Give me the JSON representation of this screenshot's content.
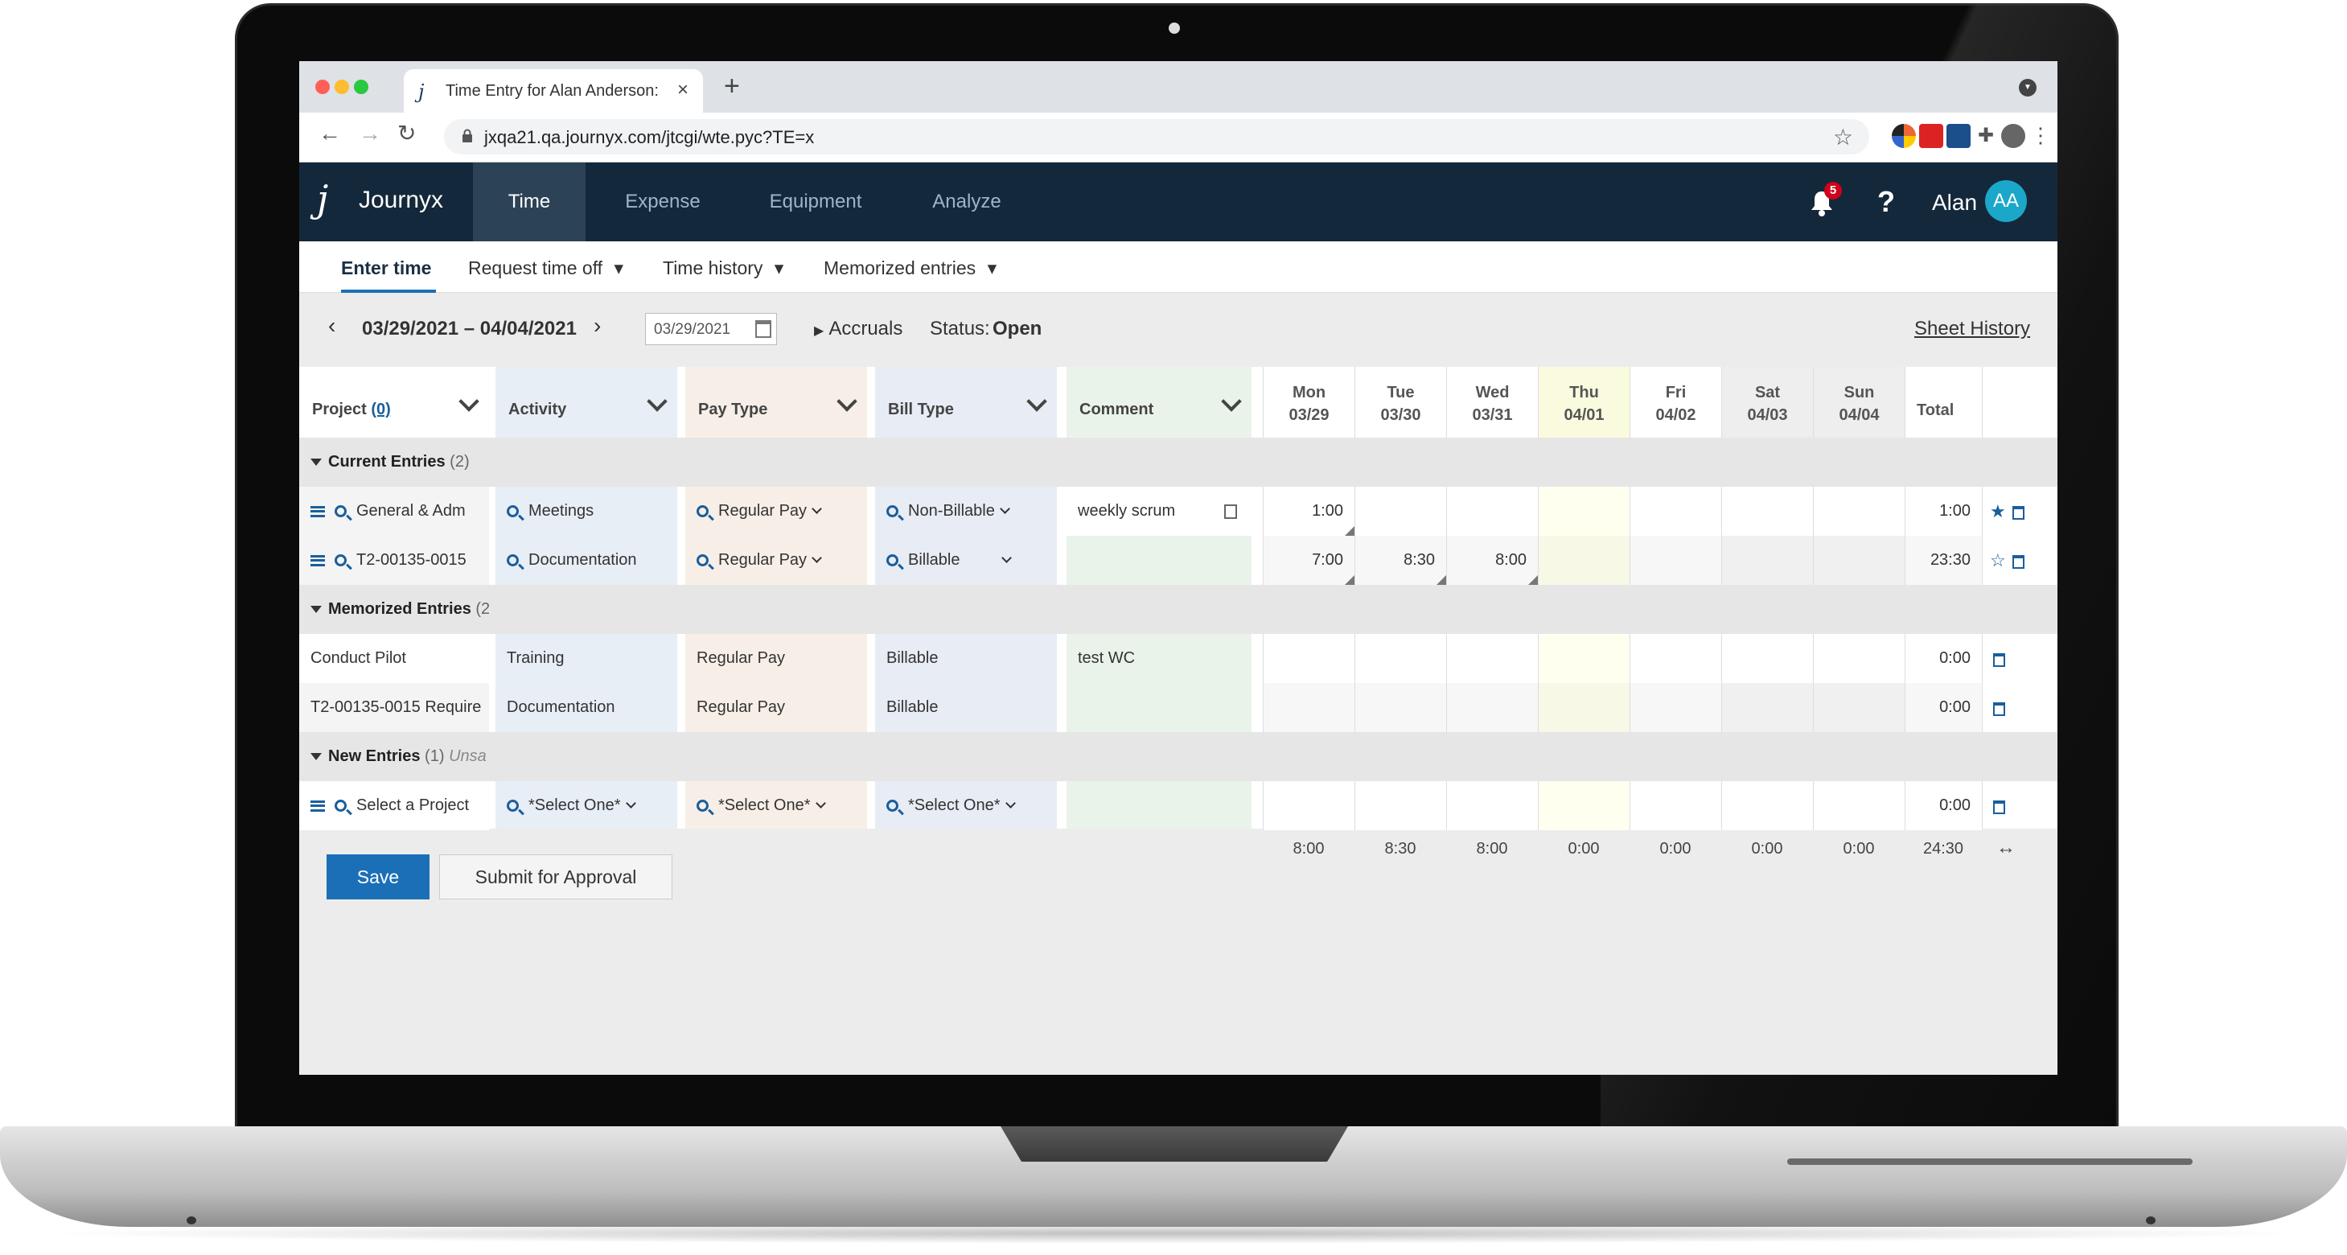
{
  "browser": {
    "tab_title": "Time Entry for Alan Anderson:",
    "tab_favicon": "j",
    "tab_close": "×",
    "new_tab": "+",
    "url": "jxqa21.qa.journyx.com/jtcgi/wte.pyc?TE=x"
  },
  "app": {
    "logo_mark": "j",
    "logo_text": "Journyx",
    "nav": [
      "Time",
      "Expense",
      "Equipment",
      "Analyze"
    ],
    "active_nav": "Time",
    "notification_count": "5",
    "help": "?",
    "user_name": "Alan",
    "avatar_initials": "AA",
    "brand_color": "#14283b",
    "accent_color": "#1b6fb7"
  },
  "subnav": {
    "enter_time": "Enter time",
    "request_time_off": "Request time off",
    "time_history": "Time history",
    "memorized_entries": "Memorized entries",
    "dropdown_glyph": "▾"
  },
  "datebar": {
    "range": "03/29/2021 – 04/04/2021",
    "date_input": "03/29/2021",
    "accruals": "Accruals",
    "status_label": "Status:",
    "status_value": "Open",
    "sheet_history": "Sheet History"
  },
  "columns": {
    "project": "Project",
    "project_count": "(0)",
    "activity": "Activity",
    "pay_type": "Pay Type",
    "bill_type": "Bill Type",
    "comment": "Comment",
    "total": "Total",
    "days": [
      {
        "day": "Mon",
        "date": "03/29"
      },
      {
        "day": "Tue",
        "date": "03/30"
      },
      {
        "day": "Wed",
        "date": "03/31"
      },
      {
        "day": "Thu",
        "date": "04/01"
      },
      {
        "day": "Fri",
        "date": "04/02"
      },
      {
        "day": "Sat",
        "date": "04/03"
      },
      {
        "day": "Sun",
        "date": "04/04"
      }
    ]
  },
  "sections": {
    "current": {
      "label": "Current Entries",
      "count": "(2)"
    },
    "memorized": {
      "label": "Memorized Entries",
      "count": "(2"
    },
    "new": {
      "label": "New Entries",
      "count": "(1)",
      "note": "Unsa"
    }
  },
  "current_entries": [
    {
      "project": "General & Adm",
      "activity": "Meetings",
      "pay_type": "Regular Pay",
      "bill_type": "Non-Billable",
      "comment": "weekly scrum",
      "hours": [
        "1:00",
        "",
        "",
        "",
        "",
        "",
        ""
      ],
      "total": "1:00",
      "star": "★"
    },
    {
      "project": "T2-00135-0015",
      "activity": "Documentation",
      "pay_type": "Regular Pay",
      "bill_type": "Billable",
      "comment": "",
      "hours": [
        "7:00",
        "8:30",
        "8:00",
        "",
        "",
        "",
        ""
      ],
      "total": "23:30",
      "star": "☆"
    }
  ],
  "memorized_entries": [
    {
      "project": "Conduct Pilot",
      "activity": "Training",
      "pay_type": "Regular Pay",
      "bill_type": "Billable",
      "comment": "test WC",
      "total": "0:00"
    },
    {
      "project": "T2-00135-0015 Require",
      "activity": "Documentation",
      "pay_type": "Regular Pay",
      "bill_type": "Billable",
      "comment": "",
      "total": "0:00"
    }
  ],
  "new_entries": [
    {
      "project": "Select a Project",
      "activity": "*Select One*",
      "pay_type": "*Select One*",
      "bill_type": "*Select One*",
      "total": "0:00"
    }
  ],
  "day_totals": [
    "8:00",
    "8:30",
    "8:00",
    "0:00",
    "0:00",
    "0:00",
    "0:00"
  ],
  "grand_total": "24:30",
  "expand_glyph": "↔",
  "buttons": {
    "save": "Save",
    "submit": "Submit for Approval"
  }
}
